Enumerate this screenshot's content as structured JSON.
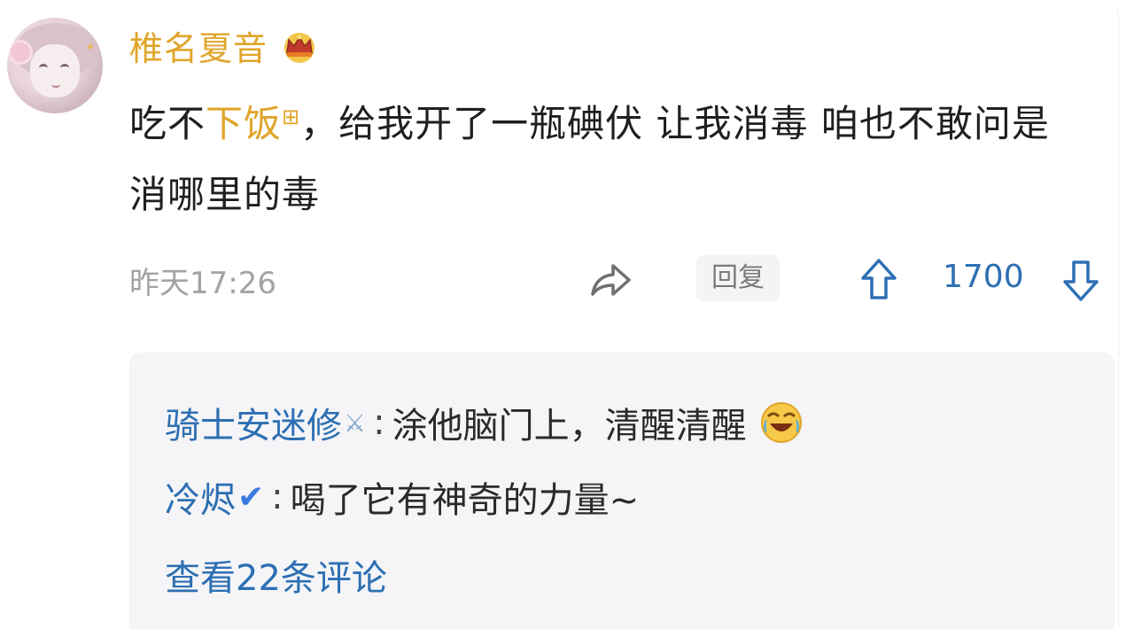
{
  "post": {
    "username": "椎名夏音",
    "text_before": "吃不",
    "text_highlight": "下饭",
    "text_after": "，给我开了一瓶碘伏 让我消毒 咱也不敢问是消哪里的毒",
    "timestamp": "昨天17:26",
    "reply_label": "回复",
    "likes": "1700"
  },
  "replies": [
    {
      "name": "骑士安迷修",
      "separator": ":",
      "text": "涂他脑门上，清醒清醒"
    },
    {
      "name": "冷烬",
      "separator": ":",
      "text": "喝了它有神奇的力量~"
    }
  ],
  "more_comments": "查看22条评论",
  "colors": {
    "username": "#e0a52a",
    "link_blue": "#2d6fb3",
    "reply_bg": "#f5f5f7",
    "meta_gray": "#a3a3a3"
  },
  "icons": [
    "crown-icon",
    "share-icon",
    "thumb-up-icon",
    "thumb-down-icon",
    "laugh-cry-emoji",
    "swords-icon",
    "checkmark-icon"
  ]
}
